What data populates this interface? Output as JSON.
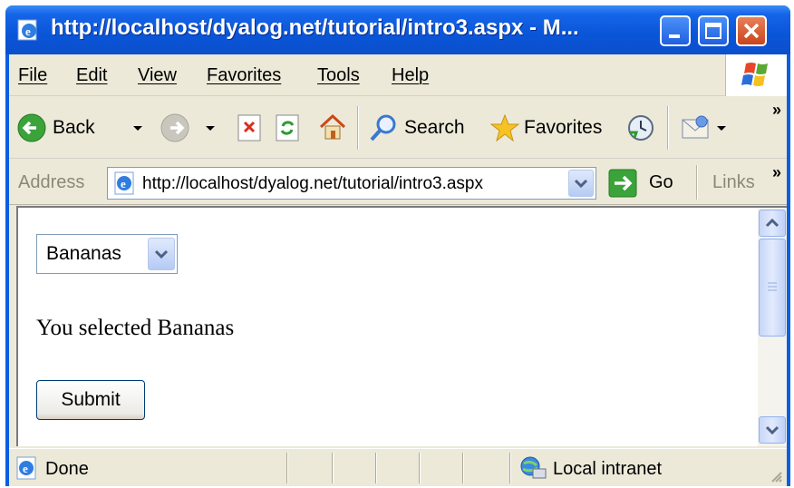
{
  "window": {
    "title": "http://localhost/dyalog.net/tutorial/intro3.aspx - M...",
    "icon": "ie-page-icon"
  },
  "menu": {
    "items": [
      "File",
      "Edit",
      "View",
      "Favorites",
      "Tools",
      "Help"
    ]
  },
  "toolbar": {
    "back_label": "Back",
    "search_label": "Search",
    "favorites_label": "Favorites",
    "overflow": "»"
  },
  "address": {
    "label": "Address",
    "url": "http://localhost/dyalog.net/tutorial/intro3.aspx",
    "go_label": "Go",
    "links_label": "Links",
    "links_overflow": "»"
  },
  "page": {
    "dropdown_value": "Bananas",
    "message": "You selected Bananas",
    "submit_label": "Submit"
  },
  "status": {
    "text": "Done",
    "zone": "Local intranet"
  },
  "colors": {
    "titlebar": "#0b55d8",
    "chrome": "#ece9d8",
    "accent_blue": "#7f9db9"
  }
}
